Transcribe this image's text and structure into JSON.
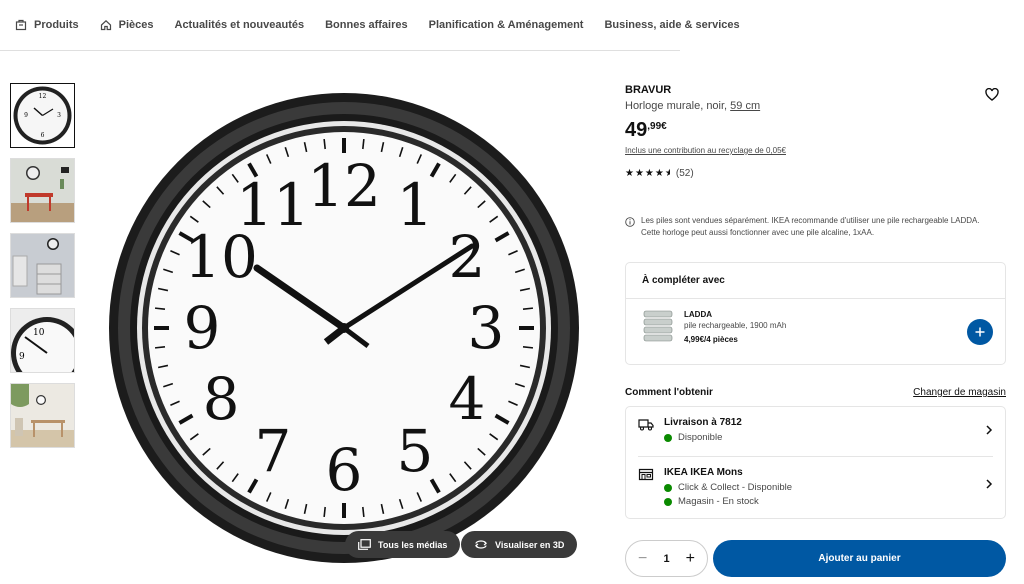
{
  "nav": {
    "items": [
      {
        "label": "Produits",
        "icon": "products-icon"
      },
      {
        "label": "Pièces",
        "icon": "home-icon"
      },
      {
        "label": "Actualités et nouveautés"
      },
      {
        "label": "Bonnes affaires"
      },
      {
        "label": "Planification & Aménagement"
      },
      {
        "label": "Business, aide & services"
      }
    ]
  },
  "gallery": {
    "thumb_count": 5,
    "buttons": {
      "all_media": "Tous les médias",
      "view_3d": "Visualiser en 3D"
    }
  },
  "product": {
    "brand": "BRAVUR",
    "description": "Horloge murale, noir,",
    "size": "59 cm",
    "price_main": "49",
    "price_decimal": ",99€",
    "recycle_note": "Inclus une contribution au recyclage de 0,05€",
    "rating_stars": 4.5,
    "rating_count": "(52)",
    "battery_note_1": "Les piles sont vendues séparément. IKEA recommande d'utiliser une pile rechargeable LADDA.",
    "battery_note_2": "Cette horloge peut aussi fonctionner avec une pile alcaline, 1xAA."
  },
  "complete": {
    "title": "À compléter avec",
    "item": {
      "name": "LADDA",
      "sub": "pile rechargeable, 1900 mAh",
      "price": "4,99€/4 pièces"
    }
  },
  "delivery": {
    "title": "Comment l'obtenir",
    "change_store": "Changer de magasin",
    "home": {
      "title": "Livraison à 7812",
      "status": "Disponible"
    },
    "store": {
      "title": "IKEA IKEA Mons",
      "line1": "Click & Collect - Disponible",
      "line2": "Magasin - En stock"
    }
  },
  "cart": {
    "quantity": "1",
    "minus": "−",
    "plus": "+",
    "add_label": "Ajouter au panier"
  },
  "colors": {
    "ikea_blue": "#0058a3",
    "available_green": "#0a8a00"
  }
}
